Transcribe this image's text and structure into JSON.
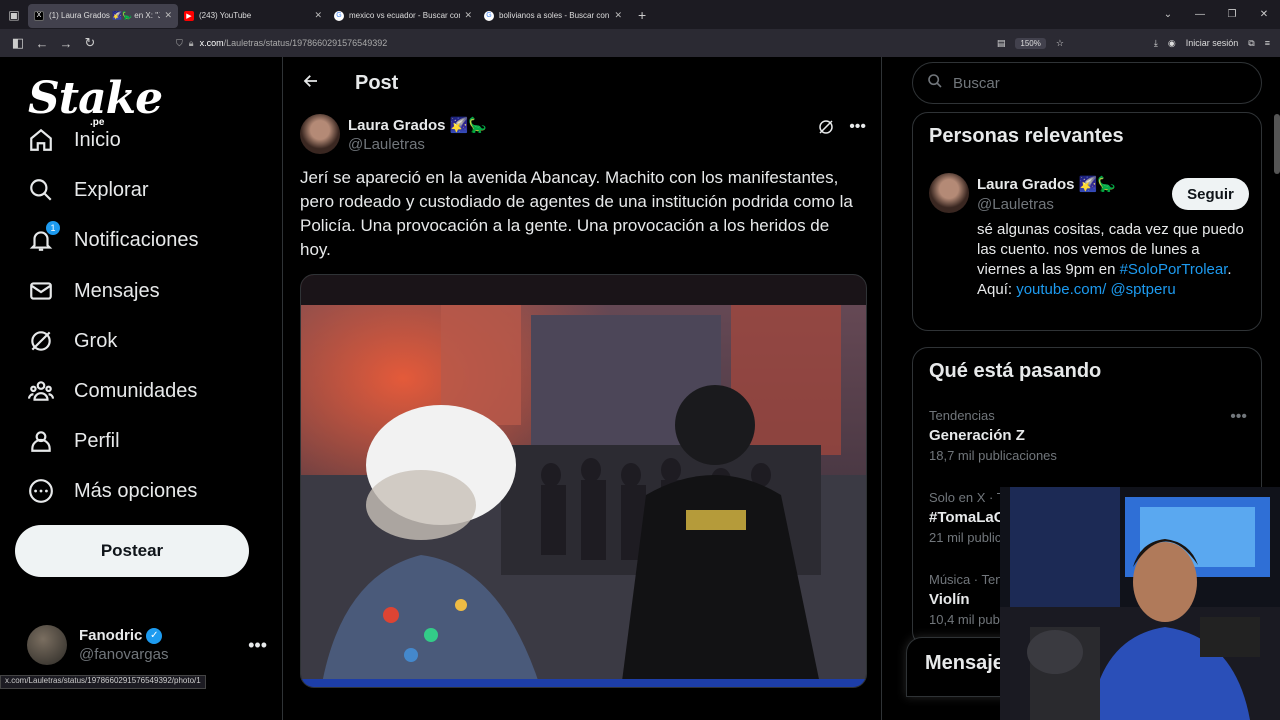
{
  "browser": {
    "tabs": [
      {
        "title": "(1) Laura Grados 🌠🦕 en X: \"J",
        "active": true,
        "favicon": "x-icon"
      },
      {
        "title": "(243) YouTube",
        "active": false,
        "favicon": "youtube-icon"
      },
      {
        "title": "mexico vs ecuador - Buscar con",
        "active": false,
        "favicon": "google-icon"
      },
      {
        "title": "bolivianos a soles - Buscar con",
        "active": false,
        "favicon": "google-icon"
      }
    ],
    "url_host": "x.com",
    "url_path": "/Lauletras/status/1978660291576549392",
    "zoom": "150%",
    "signin": "Iniciar sesión",
    "status_url": "x.com/Lauletras/status/1978660291576549392/photo/1"
  },
  "nav": {
    "logo": "Stake",
    "logo_sub": ".pe",
    "items": [
      {
        "label": "Inicio",
        "icon": "home-icon"
      },
      {
        "label": "Explorar",
        "icon": "search-icon"
      },
      {
        "label": "Notificaciones",
        "icon": "bell-icon",
        "badge": "1"
      },
      {
        "label": "Mensajes",
        "icon": "mail-icon"
      },
      {
        "label": "Grok",
        "icon": "grok-icon"
      },
      {
        "label": "Comunidades",
        "icon": "people-icon"
      },
      {
        "label": "Perfil",
        "icon": "person-icon"
      },
      {
        "label": "Más opciones",
        "icon": "more-circle-icon"
      }
    ],
    "post_button": "Postear",
    "account": {
      "name": "Fanodric",
      "handle": "@fanovargas"
    }
  },
  "main": {
    "title": "Post",
    "tweet": {
      "name": "Laura Grados 🌠🦕",
      "handle": "@Lauletras",
      "text": "Jerí se apareció en la avenida Abancay. Machito con los manifestantes, pero rodeado y custodiado de agentes de una institución podrida como la Policía. Una provocación a la gente. Una provocación a los heridos de hoy."
    }
  },
  "sidebar": {
    "search_placeholder": "Buscar",
    "relevant": {
      "title": "Personas relevantes",
      "name": "Laura Grados 🌠🦕",
      "handle": "@Lauletras",
      "follow": "Seguir",
      "bio_text": "sé algunas cositas, cada vez que puedo las cuento. nos vemos de lunes a viernes a las 9pm en ",
      "bio_tag": "#SoloPorTrolear",
      "bio_mid": ". Aquí: ",
      "bio_link": "youtube.com/",
      "bio_mention": "@sptperu"
    },
    "trending": {
      "title": "Qué está pasando",
      "items": [
        {
          "meta": "Tendencias",
          "name": "Generación Z",
          "count": "18,7 mil publicaciones"
        },
        {
          "meta": "Solo en X · T",
          "name": "#TomaLaC",
          "count": "21 mil public"
        },
        {
          "meta": "Música · Ten",
          "name": "Violín",
          "count": "10,4 mil pub"
        }
      ]
    },
    "messages": "Mensaje"
  }
}
